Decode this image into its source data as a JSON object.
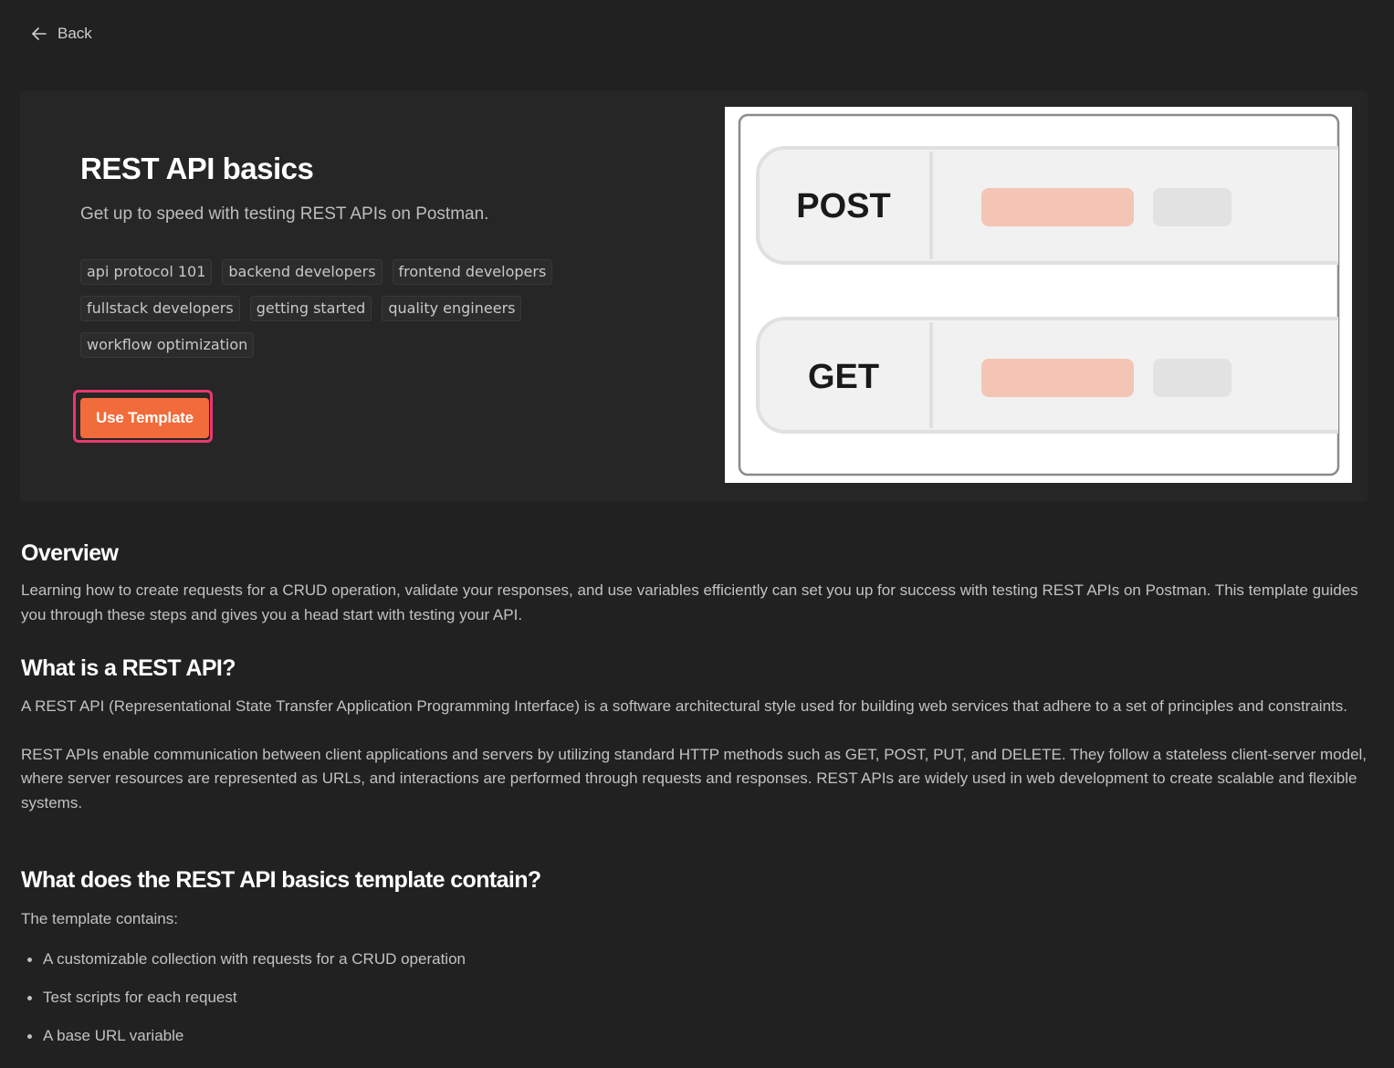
{
  "nav": {
    "back_label": "Back"
  },
  "template": {
    "title": "REST API basics",
    "subtitle": "Get up to speed with testing REST APIs on Postman.",
    "tags": [
      "api protocol 101",
      "backend developers",
      "frontend developers",
      "fullstack developers",
      "getting started",
      "quality engineers",
      "workflow optimization"
    ],
    "cta_label": "Use Template",
    "preview": {
      "methods": [
        "POST",
        "GET"
      ]
    }
  },
  "overview": {
    "heading": "Overview",
    "body": "Learning how to create requests for a CRUD operation, validate your responses, and use variables efficiently can set you up for success with testing REST APIs on Postman. This template guides you through these steps and gives you a head start with testing your API."
  },
  "what_is": {
    "heading": "What is a REST API?",
    "para1": "A REST API (Representational State Transfer Application Programming Interface) is a software architectural style used for building web services that adhere to a set of principles and constraints.",
    "para2": "REST APIs enable communication between client applications and servers by utilizing standard HTTP methods such as GET, POST, PUT, and DELETE. They follow a stateless client-server model, where server resources are represented as URLs, and interactions are performed through requests and responses. REST APIs are widely used in web development to create scalable and flexible systems."
  },
  "contains": {
    "heading": "What does the REST API basics template contain?",
    "intro": "The template contains:",
    "items": [
      "A customizable collection with requests for a CRUD operation",
      "Test scripts for each request",
      "A base URL variable"
    ]
  },
  "colors": {
    "background": "#212121",
    "card": "#262626",
    "accent": "#f26b3a",
    "highlight_outline": "#e8386f",
    "preview_bar": "#f4c5b4",
    "preview_pill": "#e2e2e2"
  },
  "icons": {
    "back": "arrow-left-icon"
  }
}
